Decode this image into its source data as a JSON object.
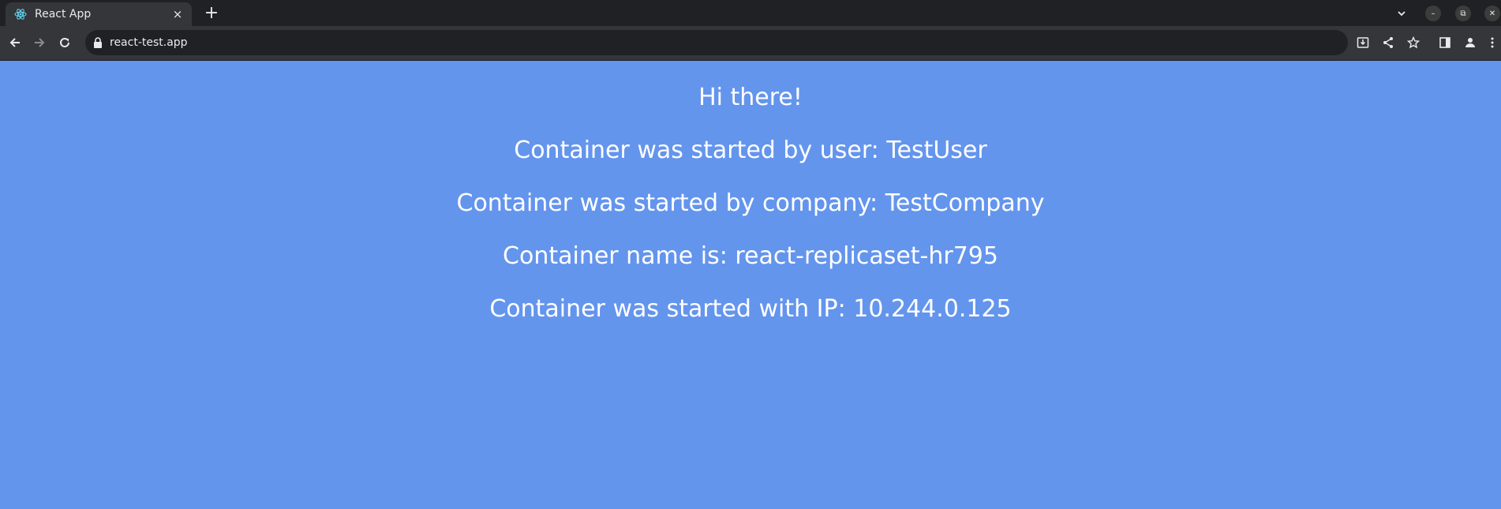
{
  "browser": {
    "tab_title": "React App",
    "tab_close": "×",
    "new_tab": "+",
    "url": "react-test.app",
    "win_minimize": "–",
    "win_restore": "⧉",
    "win_close": "✕"
  },
  "page": {
    "greeting": "Hi there!",
    "user_line": "Container was started by user: TestUser",
    "company_line": "Container was started by company: TestCompany",
    "name_line": "Container name is: react-replicaset-hr795",
    "ip_line": "Container was started with IP: 10.244.0.125"
  },
  "colors": {
    "page_background": "#6495ed",
    "text": "#ffffff",
    "browser_dark": "#202124"
  }
}
